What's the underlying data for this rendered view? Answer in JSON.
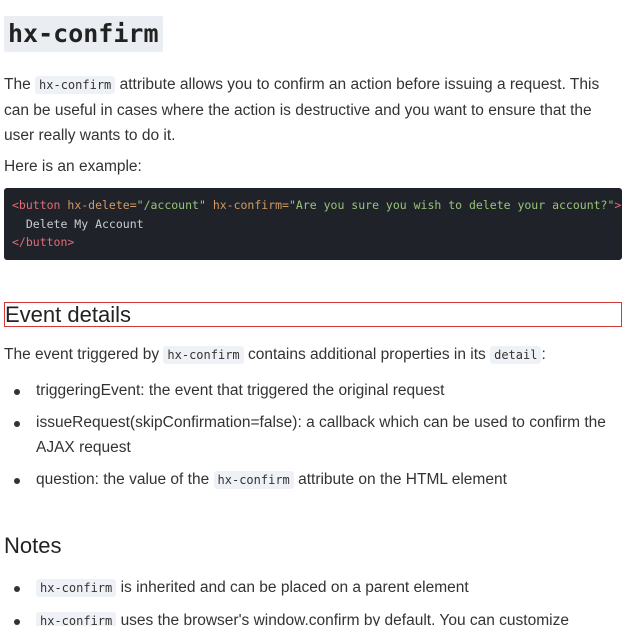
{
  "title": "hx-confirm",
  "intro": {
    "pre": "The",
    "code": "hx-confirm",
    "post": "attribute allows you to confirm an action before issuing a request. This can be useful in cases where the action is destructive and you want to ensure that the user really wants to do it."
  },
  "example_intro": "Here is an example:",
  "example_code": {
    "open_tag_start": "<button",
    "attr1_name": " hx-delete=",
    "attr1_value": "\"/account\"",
    "attr2_name": " hx-confirm=",
    "attr2_value": "\"Are you sure you wish to delete your account?\"",
    "open_tag_end": ">",
    "body": "  Delete My Account",
    "close_tag": "</button>"
  },
  "event_details": {
    "heading": "Event details",
    "text_pre": "The event triggered by",
    "code1": "hx-confirm",
    "text_mid": "contains additional properties in its",
    "code2": "detail",
    "text_post": ":",
    "items": [
      {
        "text": "triggeringEvent: the event that triggered the original request"
      },
      {
        "text": "issueRequest(skipConfirmation=false): a callback which can be used to confirm the AJAX request"
      },
      {
        "pre": "question: the value of the",
        "code": "hx-confirm",
        "post": "attribute on the HTML element"
      }
    ]
  },
  "notes": {
    "heading": "Notes",
    "items": [
      {
        "code": "hx-confirm",
        "post": "is inherited and can be placed on a parent element"
      },
      {
        "code": "hx-confirm",
        "post": "uses the browser's window.confirm by default. You can customize"
      }
    ]
  }
}
